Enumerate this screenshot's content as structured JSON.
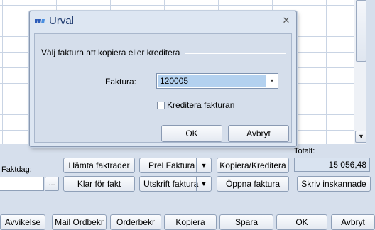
{
  "window": {
    "totalt_label": "Totalt:",
    "totalt_value": "15 056,48",
    "faktdag_label": "Faktdag:",
    "faktdag_button": "...",
    "buttons_row1": {
      "hamta": "Hämta faktrader",
      "prel": "Prel Faktura",
      "kopiera_kreditera": "Kopiera/Kreditera"
    },
    "buttons_row2": {
      "klar": "Klar för fakt",
      "utskrift": "Utskrift faktura",
      "oppna": "Öppna faktura",
      "skriv": "Skriv inskannade"
    },
    "bottom_buttons": [
      "Avvikelse",
      "Mail Ordbekr",
      "Orderbekr",
      "Kopiera",
      "Spara",
      "OK",
      "Avbryt"
    ],
    "scroll_down": "▼"
  },
  "dialog": {
    "title": "Urval",
    "close": "✕",
    "group_label": "Välj faktura att kopiera eller kreditera",
    "faktura_label": "Faktura:",
    "faktura_value": "120005",
    "combo_arrow": "▾",
    "kreditera_label": "Kreditera fakturan",
    "kreditera_checked": false,
    "ok_label": "OK",
    "cancel_label": "Avbryt"
  },
  "colors": {
    "background": "#d6dfec",
    "dialog_bg": "#dde6f2",
    "title_text": "#1e3a6e",
    "selection": "#b3d1ef"
  }
}
